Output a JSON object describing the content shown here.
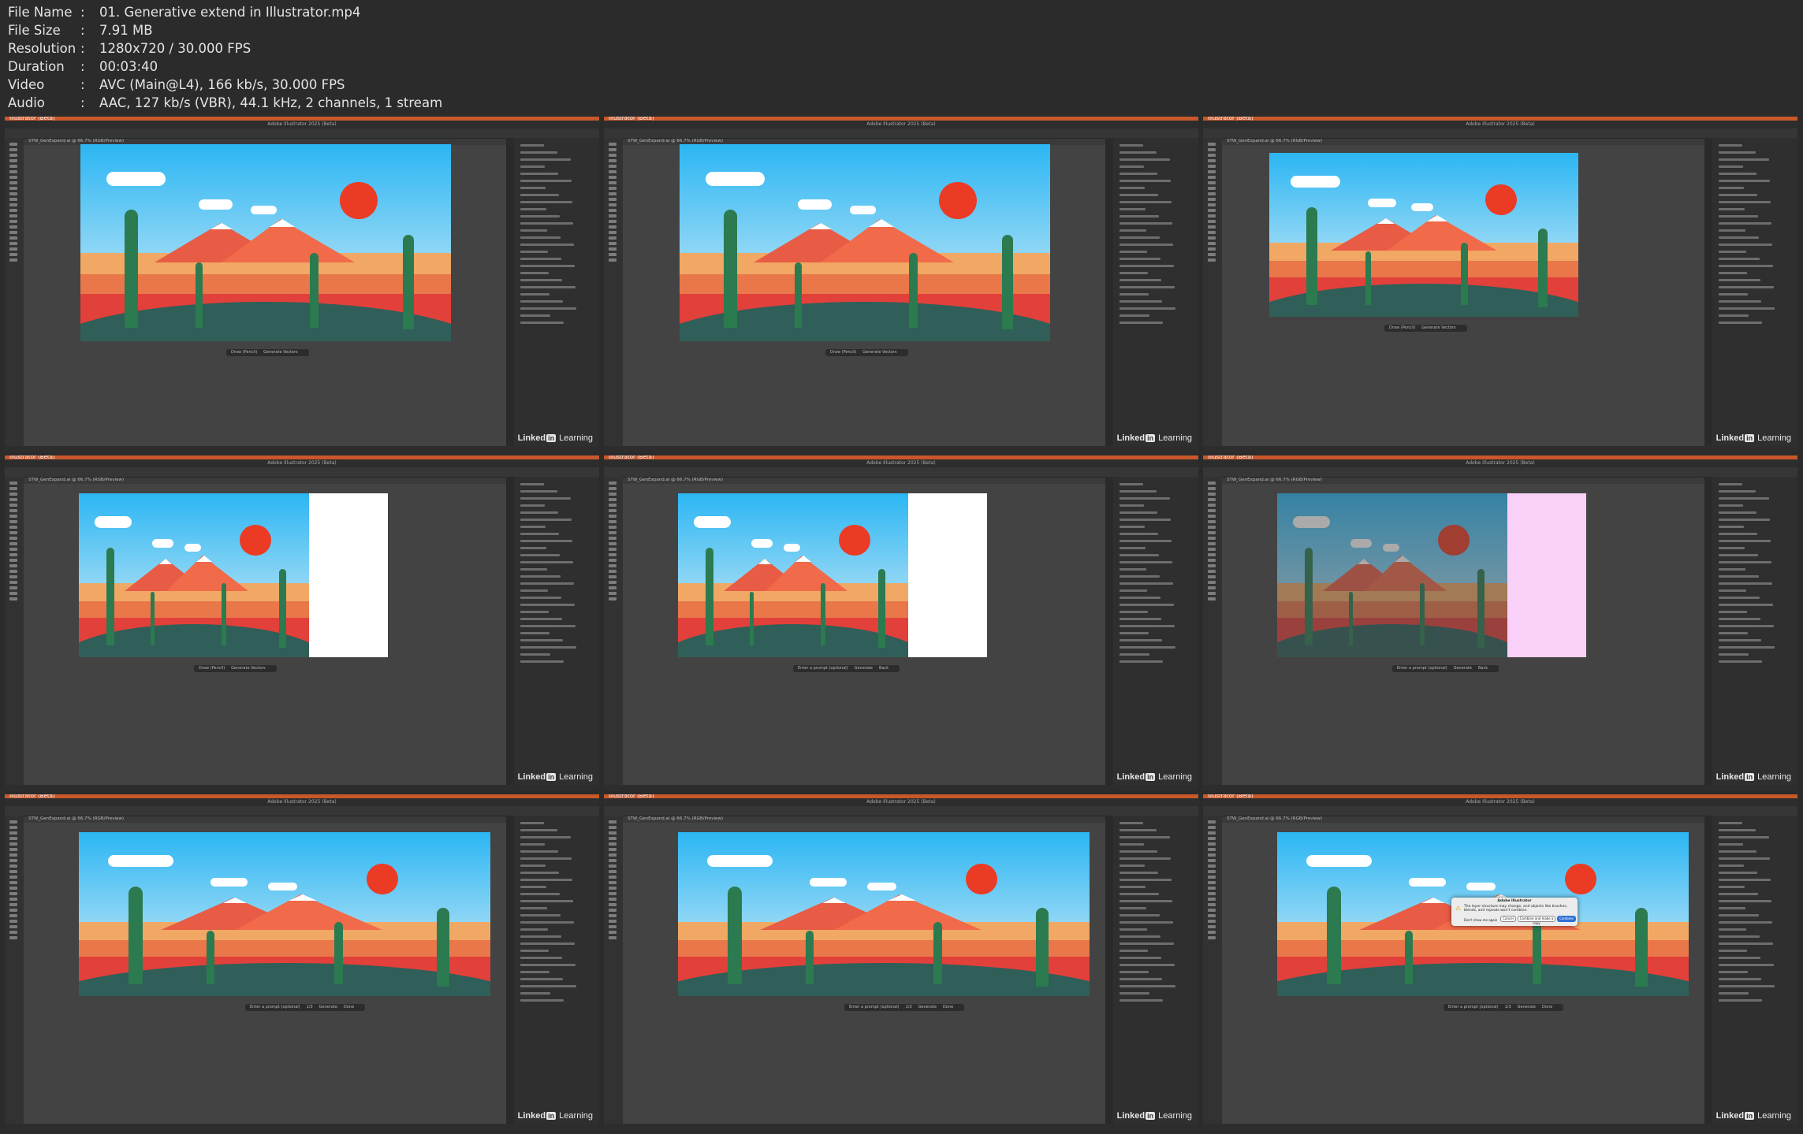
{
  "file_info": [
    {
      "key": "File Name",
      "value": "01. Generative extend in Illustrator.mp4"
    },
    {
      "key": "File Size",
      "value": "7.91 MB"
    },
    {
      "key": "Resolution",
      "value": "1280x720 / 30.000 FPS"
    },
    {
      "key": "Duration",
      "value": "00:03:40"
    },
    {
      "key": "Video",
      "value": "AVC (Main@L4), 166 kb/s, 30.000 FPS"
    },
    {
      "key": "Audio",
      "value": "AAC, 127 kb/s (VBR), 44.1 kHz, 2 channels, 1 stream"
    }
  ],
  "separator": ":",
  "app": {
    "name": "Illustrator (Beta)",
    "window_title": "Adobe Illustrator 2025 (Beta)",
    "doc_tab": "STW_GenExpand.ai @ 66.7% (RGB/Preview)"
  },
  "context_bar": {
    "shape": "Draw (Pencil)",
    "vectors": "Generate Vectors",
    "prompt": "Enter a prompt (optional)",
    "generate": "Generate",
    "back": "Back",
    "page": "1/3",
    "done": "Done"
  },
  "watermark": {
    "brand_a": "Linked",
    "brand_in": "in",
    "brand_b": "Learning"
  },
  "dialog": {
    "title": "Adobe Illustrator",
    "message": "The layer structure may change, and objects like brushes, blends, and repeats won't combine.",
    "checkbox": "Don't show me again",
    "cancel": "Cancel",
    "combine_copy": "Combine and make a copy",
    "combine": "Combine"
  },
  "colors": {
    "menubar": "#c8582a",
    "sky": "#2bb6f3",
    "sun": "#ec3b25",
    "cactus": "#2c7a50",
    "extend_white": "#ffffff",
    "extend_pink": "#f9d0f7"
  },
  "thumbs": [
    {
      "state": "original",
      "bar": "shape"
    },
    {
      "state": "original",
      "bar": "shape"
    },
    {
      "state": "scaled",
      "bar": "shape"
    },
    {
      "state": "white-extend",
      "bar": "shape"
    },
    {
      "state": "white-extend-select",
      "bar": "prompt"
    },
    {
      "state": "pink-generating",
      "bar": "prompt"
    },
    {
      "state": "extended",
      "bar": "page"
    },
    {
      "state": "extended",
      "bar": "page"
    },
    {
      "state": "extended-dialog",
      "bar": "page"
    }
  ]
}
